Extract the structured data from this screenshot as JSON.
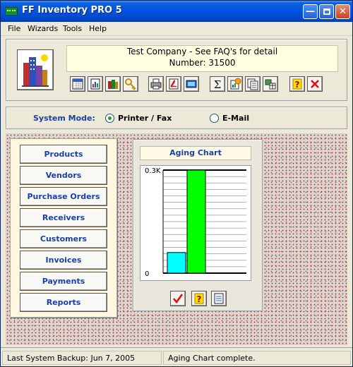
{
  "window": {
    "title": "FF Inventory PRO 5"
  },
  "menu": [
    "File",
    "Wizards",
    "Tools",
    "Help"
  ],
  "header": {
    "company_line": "Test Company - See FAQ's for detail",
    "number_line": "Number: 31500"
  },
  "toolbar_icons": [
    "calendar-icon",
    "report-icon",
    "books-icon",
    "key-icon",
    "printer-icon",
    "pdf-icon",
    "display-icon",
    "sigma-icon",
    "chart-doc-icon",
    "copy-icon",
    "grid-icon",
    "help-icon",
    "exit-icon"
  ],
  "system_mode": {
    "label": "System Mode:",
    "options": [
      "Printer / Fax",
      "E-Mail"
    ],
    "selected": "Printer / Fax"
  },
  "nav": [
    "Products",
    "Vendors",
    "Purchase Orders",
    "Receivers",
    "Customers",
    "Invoices",
    "Payments",
    "Reports"
  ],
  "aging_chart": {
    "title": "Aging Chart"
  },
  "chart_data": {
    "type": "bar",
    "title": "Aging Chart",
    "categories": [
      "",
      ""
    ],
    "values": [
      0.06,
      0.3
    ],
    "colors": [
      "#00ffff",
      "#00ff00"
    ],
    "ylim": [
      0,
      0.3
    ],
    "ytick_labels": [
      "0.3K",
      "0"
    ],
    "grid": true
  },
  "status": {
    "backup": "Last System Backup: Jun 7, 2005",
    "message": "Aging Chart complete."
  },
  "colors": {
    "title_blue": "#0054e3",
    "label_blue": "#1a3fa6",
    "info_bg": "#ffffe1",
    "bar_1": "#00ffff",
    "bar_2": "#00ff00"
  }
}
